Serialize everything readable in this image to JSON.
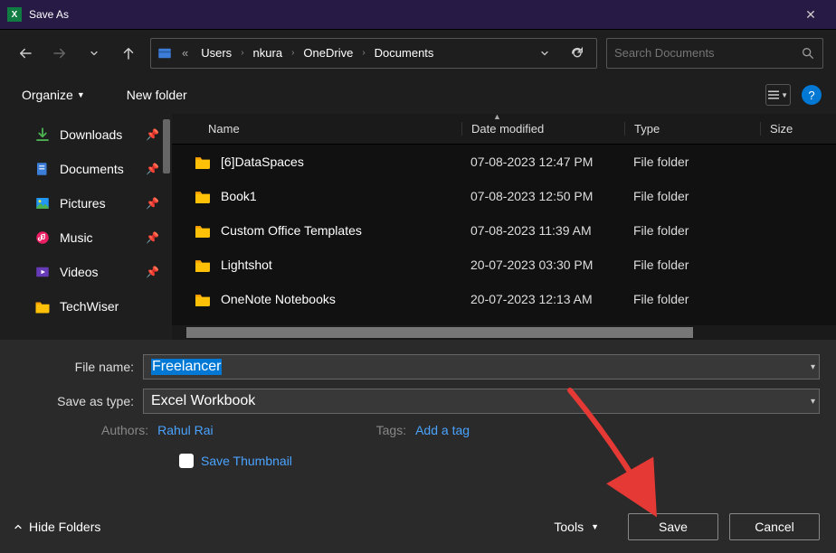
{
  "window": {
    "title": "Save As"
  },
  "breadcrumb": {
    "root_hint": "«",
    "items": [
      "Users",
      "nkura",
      "OneDrive",
      "Documents"
    ]
  },
  "search": {
    "placeholder": "Search Documents"
  },
  "toolbar": {
    "organize": "Organize",
    "new_folder": "New folder"
  },
  "sidebar": {
    "items": [
      {
        "label": "Downloads",
        "icon": "download",
        "pinned": true
      },
      {
        "label": "Documents",
        "icon": "doc",
        "pinned": true
      },
      {
        "label": "Pictures",
        "icon": "pic",
        "pinned": true
      },
      {
        "label": "Music",
        "icon": "music",
        "pinned": true
      },
      {
        "label": "Videos",
        "icon": "video",
        "pinned": true
      },
      {
        "label": "TechWiser",
        "icon": "folder",
        "pinned": false
      }
    ]
  },
  "columns": {
    "name": "Name",
    "date": "Date modified",
    "type": "Type",
    "size": "Size"
  },
  "rows": [
    {
      "name": "[6]DataSpaces",
      "date": "07-08-2023 12:47 PM",
      "type": "File folder"
    },
    {
      "name": "Book1",
      "date": "07-08-2023 12:50 PM",
      "type": "File folder"
    },
    {
      "name": "Custom Office Templates",
      "date": "07-08-2023 11:39 AM",
      "type": "File folder"
    },
    {
      "name": "Lightshot",
      "date": "20-07-2023 03:30 PM",
      "type": "File folder"
    },
    {
      "name": "OneNote Notebooks",
      "date": "20-07-2023 12:13 AM",
      "type": "File folder"
    }
  ],
  "form": {
    "file_name_label": "File name:",
    "file_name_value": "Freelancer",
    "type_label": "Save as type:",
    "type_value": "Excel Workbook",
    "authors_label": "Authors:",
    "authors_value": "Rahul Rai",
    "tags_label": "Tags:",
    "tags_value": "Add a tag",
    "save_thumbnail": "Save Thumbnail"
  },
  "footer": {
    "hide_folders": "Hide Folders",
    "tools": "Tools",
    "save": "Save",
    "cancel": "Cancel"
  }
}
